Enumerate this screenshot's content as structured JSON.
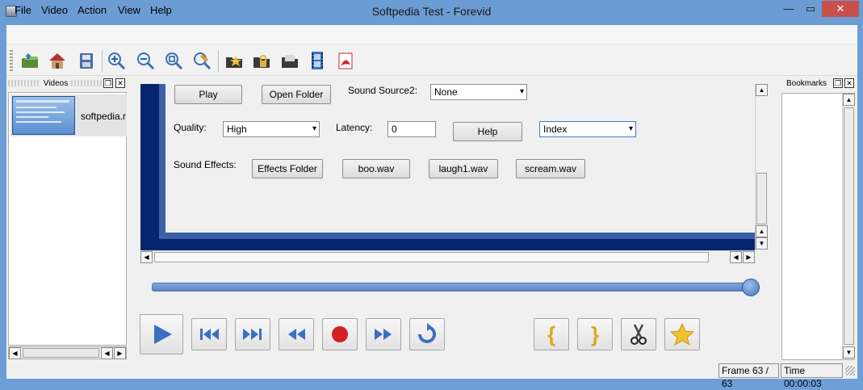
{
  "window": {
    "title": "Softpedia Test - Forevid",
    "min_glyph": "—",
    "max_glyph": "▭",
    "close_glyph": "✕"
  },
  "menu": [
    "File",
    "Video",
    "Action",
    "View",
    "Help"
  ],
  "toolbar": {
    "icons": [
      "open-folder-icon",
      "home-icon",
      "save-icon",
      "zoom-in-icon",
      "zoom-out-icon",
      "zoom-fit-icon",
      "zoom-custom-icon",
      "star-folder-icon",
      "lock-folder-icon",
      "folder-icon",
      "film-icon",
      "pdf-icon"
    ]
  },
  "videos_dock": {
    "title": "Videos",
    "items": [
      {
        "name": "softpedia.r"
      }
    ]
  },
  "bookmarks_dock": {
    "title": "Bookmarks"
  },
  "preview": {
    "play_label": "Play",
    "open_folder_label": "Open Folder",
    "sound_source_label": "Sound Source2:",
    "sound_source_value": "None",
    "quality_label": "Quality:",
    "quality_value": "High",
    "latency_label": "Latency:",
    "latency_value": "0",
    "help_label": "Help",
    "index_value": "Index",
    "sound_effects_label": "Sound Effects:",
    "effects_folder_label": "Effects Folder",
    "effects": [
      "boo.wav",
      "laugh1.wav",
      "scream.wav"
    ]
  },
  "seek": {
    "position": 1.0
  },
  "transport": {
    "buttons": [
      "play-icon",
      "skip-start-icon",
      "skip-end-icon",
      "rewind-icon",
      "record-icon",
      "fast-forward-icon",
      "repeat-icon"
    ],
    "edit_buttons": [
      "mark-in-icon",
      "mark-out-icon",
      "cut-icon",
      "bookmark-star-icon"
    ],
    "mark_in_glyph": "{",
    "mark_out_glyph": "}"
  },
  "status": {
    "frame": "Frame 63 / 63",
    "time": "Time 00:00:03"
  },
  "colors": {
    "titlebar": "#6b9cd4",
    "accent_blue": "#3d6fc0",
    "preview_dark": "#05256e",
    "record": "#d42020",
    "star": "#f2c12e"
  }
}
